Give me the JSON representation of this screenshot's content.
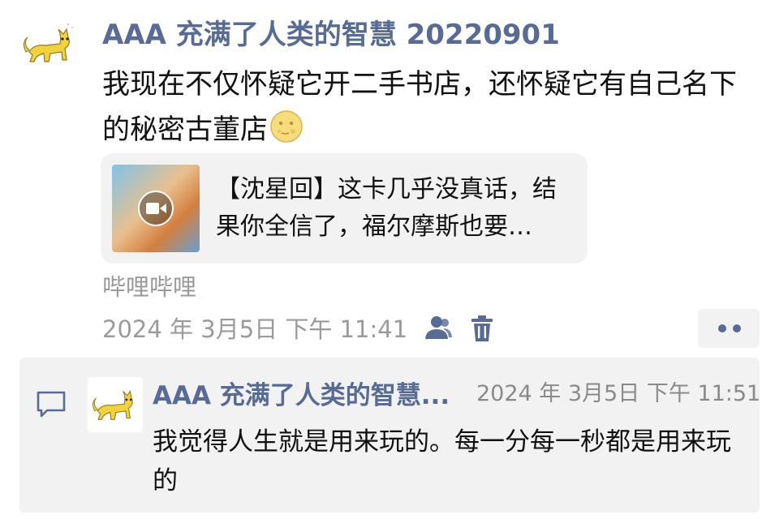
{
  "post": {
    "author": "AAA 充满了人类的智慧 20220901",
    "text": "我现在不仅怀疑它开二手书店，还怀疑它有自己名下的秘密古董店",
    "emoji": "moon-face-icon"
  },
  "link_card": {
    "title": "【沈星回】这卡几乎没真话，结果你全信了，福尔摩斯也要…",
    "thumbnail_icon": "video-play-icon"
  },
  "source": "哔哩哔哩",
  "timestamp": "2024 年 3月5日  下午 11:41",
  "comment": {
    "author": "AAA 充满了人类的智慧...",
    "time": "2024 年 3月5日  下午 11:51",
    "text": "我觉得人生就是用来玩的。每一分每一秒都是用来玩的"
  },
  "colors": {
    "name_blue": "#576b95",
    "meta_gray": "#9a9a9a",
    "panel_bg": "#f2f2f2"
  }
}
